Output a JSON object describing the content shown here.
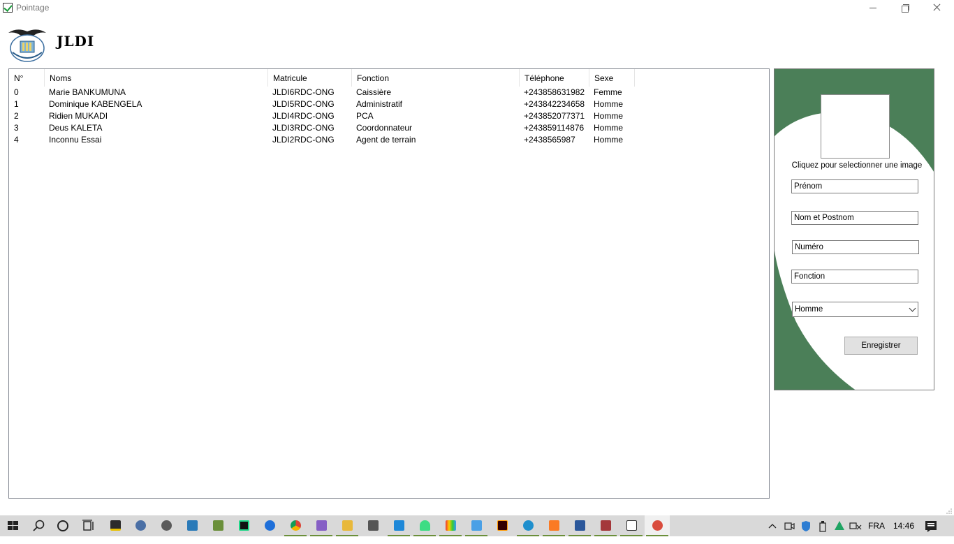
{
  "window": {
    "title": "Pointage"
  },
  "header": {
    "org_name": "JLDI",
    "logo_icon": "eagle-emblem-logo"
  },
  "table": {
    "columns": [
      "N°",
      "Noms",
      "Matricule",
      "Fonction",
      "Téléphone",
      "Sexe"
    ],
    "rows": [
      [
        "0",
        "Marie BANKUMUNA",
        "JLDI6RDC-ONG",
        "Caissière",
        "+243858631982",
        "Femme"
      ],
      [
        "1",
        "Dominique KABENGELA",
        "JLDI5RDC-ONG",
        "Administratif",
        "+243842234658",
        "Homme"
      ],
      [
        "2",
        "Ridien MUKADI",
        "JLDI4RDC-ONG",
        "PCA",
        "+243852077371",
        "Homme"
      ],
      [
        "3",
        "Deus KALETA",
        "JLDI3RDC-ONG",
        "Coordonnateur",
        "+243859114876",
        "Homme"
      ],
      [
        "4",
        "Inconnu Essai",
        "JLDI2RDC-ONG",
        "Agent de terrain",
        "+2438565987",
        "Homme"
      ]
    ]
  },
  "form": {
    "photo_caption": "Cliquez pour selectionner une image",
    "prenom": "Prénom",
    "nom_postnom": "Nom et Postnom",
    "numero": "Numéro",
    "fonction": "Fonction",
    "sexe_selected": "Homme",
    "save_label": "Enregistrer",
    "accent_color": "#4b7f58"
  },
  "taskbar": {
    "apps": [
      "windows-start-icon",
      "search-icon",
      "cortana-icon",
      "task-view-icon",
      "sticky-notes-icon",
      "paint-icon",
      "media-icon",
      "photos-icon",
      "android-studio-icon",
      "pycharm-icon",
      "bluetooth-icon",
      "chrome-icon",
      "visual-studio-icon",
      "file-explorer-icon",
      "calculator-icon",
      "vscode-icon",
      "android-icon",
      "vlc-icon",
      "notepad-icon",
      "illustrator-icon",
      "edge-icon",
      "xampp-icon",
      "word-icon",
      "access-icon",
      "pointage-app-icon",
      "paint-brush-icon"
    ],
    "language": "FRA",
    "time": "14:46"
  }
}
